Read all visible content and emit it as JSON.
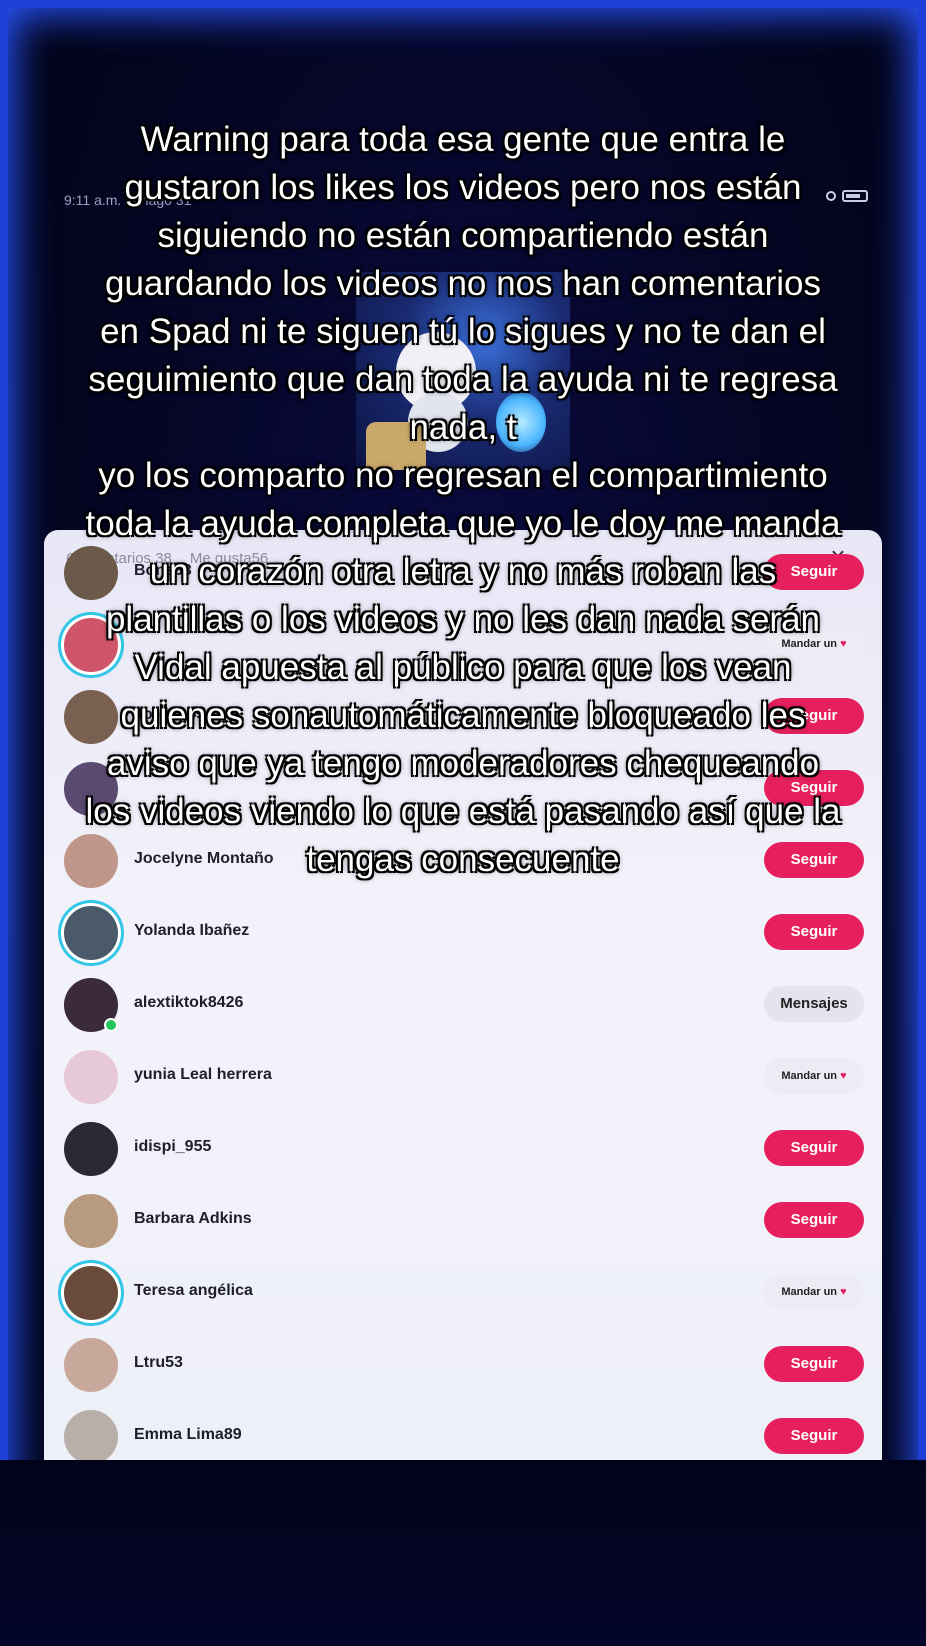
{
  "status": {
    "time": "9:11 a.m.  Lunago 31"
  },
  "panel": {
    "tab_comments": "Comentarios 38",
    "tab_likes": "Me gusta56",
    "close": "×"
  },
  "rows": [
    {
      "name": "Bone63",
      "button": "Seguir",
      "kind": "follow",
      "avatar_color": "#6b5a4a"
    },
    {
      "name": "",
      "button": "Mandar un",
      "kind": "send",
      "avatar_color": "#d0556a"
    },
    {
      "name": "Jordan45",
      "button": "Seguir",
      "kind": "follow",
      "avatar_color": "#7a6050"
    },
    {
      "name": "",
      "button": "Seguir",
      "kind": "follow",
      "avatar_color": "#5a4a70"
    },
    {
      "name": "Jocelyne Montaño",
      "button": "Seguir",
      "kind": "follow",
      "avatar_color": "#c0968a"
    },
    {
      "name": "Yolanda Ibañez",
      "button": "Seguir",
      "kind": "follow",
      "avatar_color": "#4a5a6a"
    },
    {
      "name": "alextiktok8426",
      "button": "Mensajes",
      "kind": "msg",
      "avatar_color": "#3a2a3a"
    },
    {
      "name": "yunia Leal herrera",
      "button": "Mandar un",
      "kind": "send",
      "avatar_color": "#e6c8d8"
    },
    {
      "name": "idispi_955",
      "button": "Seguir",
      "kind": "follow",
      "avatar_color": "#2a2a34"
    },
    {
      "name": "Barbara Adkins",
      "button": "Seguir",
      "kind": "follow",
      "avatar_color": "#b89a80"
    },
    {
      "name": "Teresa angélica",
      "button": "Mandar un",
      "kind": "send",
      "avatar_color": "#6a4a3a"
    },
    {
      "name": "Ltru53",
      "button": "Seguir",
      "kind": "follow",
      "avatar_color": "#c8a89a"
    },
    {
      "name": "Emma Lima89",
      "button": "Seguir",
      "kind": "follow",
      "avatar_color": "#b8b0a8"
    }
  ],
  "caption": [
    "Warning para toda esa gente que entra le",
    "gustaron los likes los videos pero nos están",
    "siguiendo no están compartiendo están",
    "guardando los videos no nos han comentarios",
    "en Spad ni te siguen tú lo sigues y no te dan el",
    "seguimiento que dan toda la ayuda ni te regresa",
    "nada, t",
    "yo los comparto  no regresan el compartimiento",
    "toda la ayuda completa que yo le doy me manda",
    "un corazón  otra letra y no más roban las",
    "plantillas o los videos y no les dan nada  serán",
    "Vidal apuesta al público para que los vean",
    "quienes sonautomáticamente bloqueado  les",
    "aviso que ya tengo moderadores chequeando",
    "los videos viendo lo que está pasando así que la",
    "tengas consecuente"
  ]
}
